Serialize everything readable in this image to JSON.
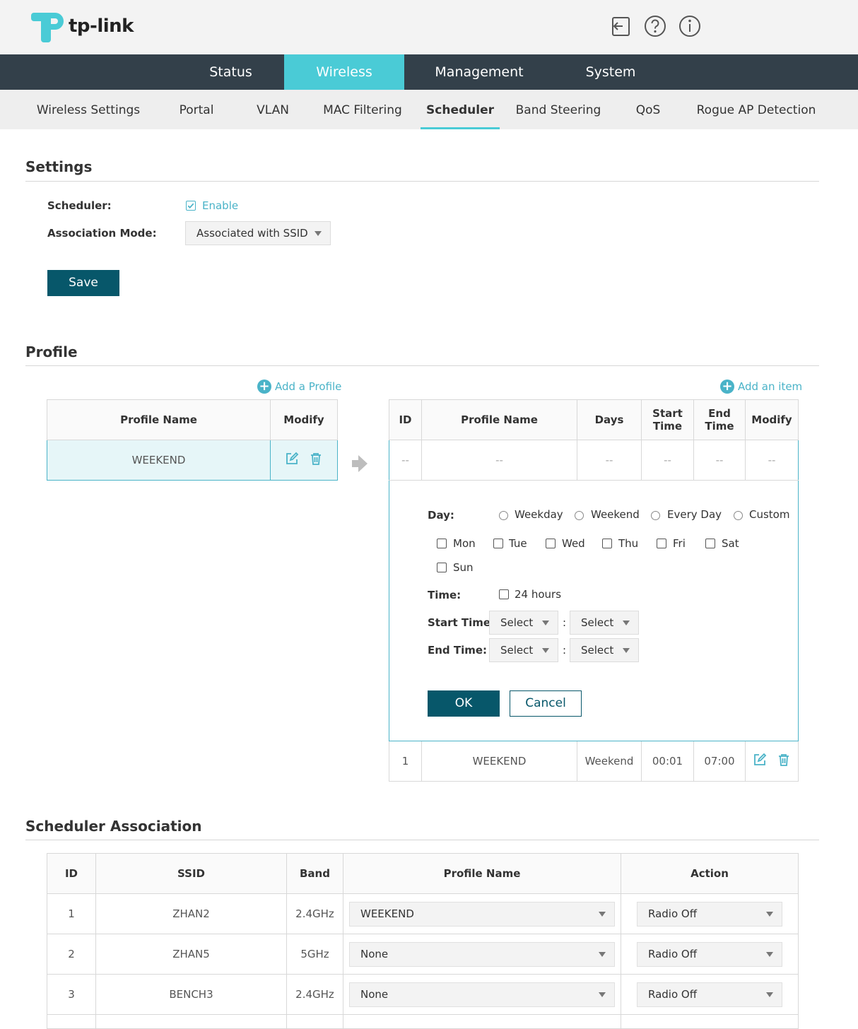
{
  "header": {
    "brand": "tp-link",
    "icons": [
      "logout-icon",
      "help-icon",
      "info-icon"
    ]
  },
  "main_nav": {
    "tabs": [
      {
        "label": "Status"
      },
      {
        "label": "Wireless",
        "active": true
      },
      {
        "label": "Management"
      },
      {
        "label": "System"
      }
    ]
  },
  "sub_nav": {
    "tabs": [
      {
        "label": "Wireless Settings"
      },
      {
        "label": "Portal"
      },
      {
        "label": "VLAN"
      },
      {
        "label": "MAC Filtering"
      },
      {
        "label": "Scheduler",
        "active": true
      },
      {
        "label": "Band Steering"
      },
      {
        "label": "QoS"
      },
      {
        "label": "Rogue AP Detection"
      }
    ]
  },
  "settings": {
    "title": "Settings",
    "scheduler_label": "Scheduler:",
    "scheduler_checkbox": {
      "label": "Enable",
      "checked": true
    },
    "mode_label": "Association Mode:",
    "mode_value": "Associated with SSID",
    "save_label": "Save"
  },
  "profile": {
    "title": "Profile",
    "add_profile_label": "Add a Profile",
    "add_item_label": "Add an item",
    "profiles_table": {
      "headers": [
        "Profile Name",
        "Modify"
      ],
      "rows": [
        {
          "name": "WEEKEND",
          "selected": true
        }
      ]
    },
    "items_table": {
      "headers": [
        "ID",
        "Profile Name",
        "Days",
        "Start Time",
        "End Time",
        "Modify"
      ],
      "placeholder_row": [
        "--",
        "--",
        "--",
        "--",
        "--",
        "--"
      ],
      "rows": [
        {
          "id": "1",
          "profile": "WEEKEND",
          "days": "Weekend",
          "start": "00:01",
          "end": "07:00"
        }
      ]
    },
    "editor": {
      "day_label": "Day:",
      "day_options": [
        "Weekday",
        "Weekend",
        "Every Day",
        "Custom"
      ],
      "weekdays": [
        "Mon",
        "Tue",
        "Wed",
        "Thu",
        "Fri",
        "Sat",
        "Sun"
      ],
      "time_label": "Time:",
      "hours24_label": "24 hours",
      "start_label": "Start Time:",
      "end_label": "End Time:",
      "select_placeholder": "Select",
      "colon": ":",
      "ok_label": "OK",
      "cancel_label": "Cancel"
    }
  },
  "association": {
    "title": "Scheduler Association",
    "headers": [
      "ID",
      "SSID",
      "Band",
      "Profile Name",
      "Action"
    ],
    "rows": [
      {
        "id": "1",
        "ssid": "ZHAN2",
        "band": "2.4GHz",
        "profile": "WEEKEND",
        "action": "Radio Off"
      },
      {
        "id": "2",
        "ssid": "ZHAN5",
        "band": "5GHz",
        "profile": "None",
        "action": "Radio Off"
      },
      {
        "id": "3",
        "ssid": "BENCH3",
        "band": "2.4GHz",
        "profile": "None",
        "action": "Radio Off"
      }
    ]
  },
  "colors": {
    "accent": "#4acbd6",
    "nav_dark": "#33404a",
    "button_dark": "#07576a",
    "link": "#4ab3c8"
  }
}
